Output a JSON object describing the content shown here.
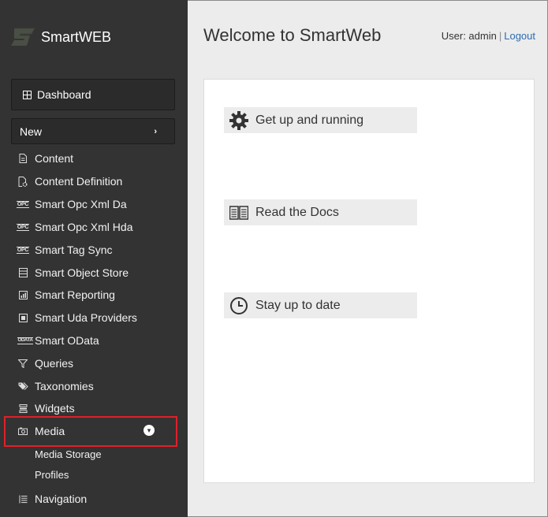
{
  "brand": {
    "name": "SmartWEB"
  },
  "header": {
    "title": "Welcome to SmartWeb",
    "user_label": "User: admin",
    "separator": "|",
    "logout": "Logout"
  },
  "sidebar": {
    "dashboard": "Dashboard",
    "new": "New",
    "items": [
      {
        "label": "Content",
        "icon": "document-icon"
      },
      {
        "label": "Content Definition",
        "icon": "document-gear-icon"
      },
      {
        "label": "Smart Opc Xml Da",
        "icon": "opc-icon"
      },
      {
        "label": "Smart Opc Xml Hda",
        "icon": "opc-icon"
      },
      {
        "label": "Smart Tag Sync",
        "icon": "opc-icon"
      },
      {
        "label": "Smart Object Store",
        "icon": "list-box-icon"
      },
      {
        "label": "Smart Reporting",
        "icon": "bar-chart-icon"
      },
      {
        "label": "Smart Uda Providers",
        "icon": "square-icon"
      },
      {
        "label": "Smart OData",
        "icon": "odata-icon"
      },
      {
        "label": "Queries",
        "icon": "filter-icon"
      },
      {
        "label": "Taxonomies",
        "icon": "tags-icon"
      },
      {
        "label": "Widgets",
        "icon": "widgets-icon"
      },
      {
        "label": "Media",
        "icon": "camera-icon"
      },
      {
        "label": "Navigation",
        "icon": "list-icon"
      }
    ],
    "opc_badge": "OPC",
    "odata_badge": "ODATA",
    "media_sub": [
      "Media Storage",
      "Profiles"
    ]
  },
  "main": {
    "tiles": [
      {
        "label": "Get up and running",
        "icon": "gear-icon"
      },
      {
        "label": "Read the Docs",
        "icon": "book-icon"
      },
      {
        "label": "Stay up to date",
        "icon": "clock-icon"
      }
    ]
  },
  "colors": {
    "sidebar_bg": "#333333",
    "highlight_border": "#e0202a",
    "link": "#2a6db0"
  }
}
